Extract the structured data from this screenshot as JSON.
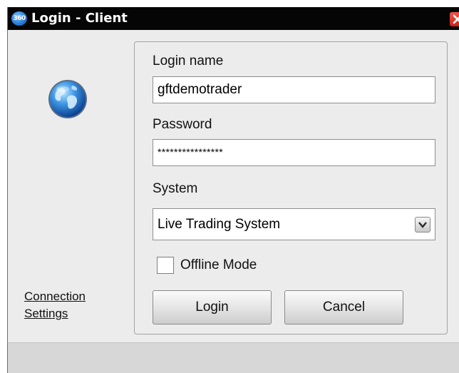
{
  "window": {
    "app_badge": "360",
    "title": "Login - Client"
  },
  "icons": {
    "app": "app-logo-icon",
    "close": "close-icon",
    "globe": "globe-icon",
    "dropdown": "chevron-down-icon"
  },
  "form": {
    "login_name_label": "Login name",
    "login_name_value": "gftdemotrader",
    "password_label": "Password",
    "password_value": "****************",
    "system_label": "System",
    "system_value": "Live Trading System",
    "offline_mode_label": "Offline Mode",
    "offline_mode_checked": false
  },
  "buttons": {
    "login": "Login",
    "cancel": "Cancel"
  },
  "sidebar": {
    "connection_line1": "Connection",
    "connection_line2": "Settings"
  },
  "colors": {
    "titlebar": "#050505",
    "close": "#d93a2c",
    "window_bg": "#ececec"
  }
}
